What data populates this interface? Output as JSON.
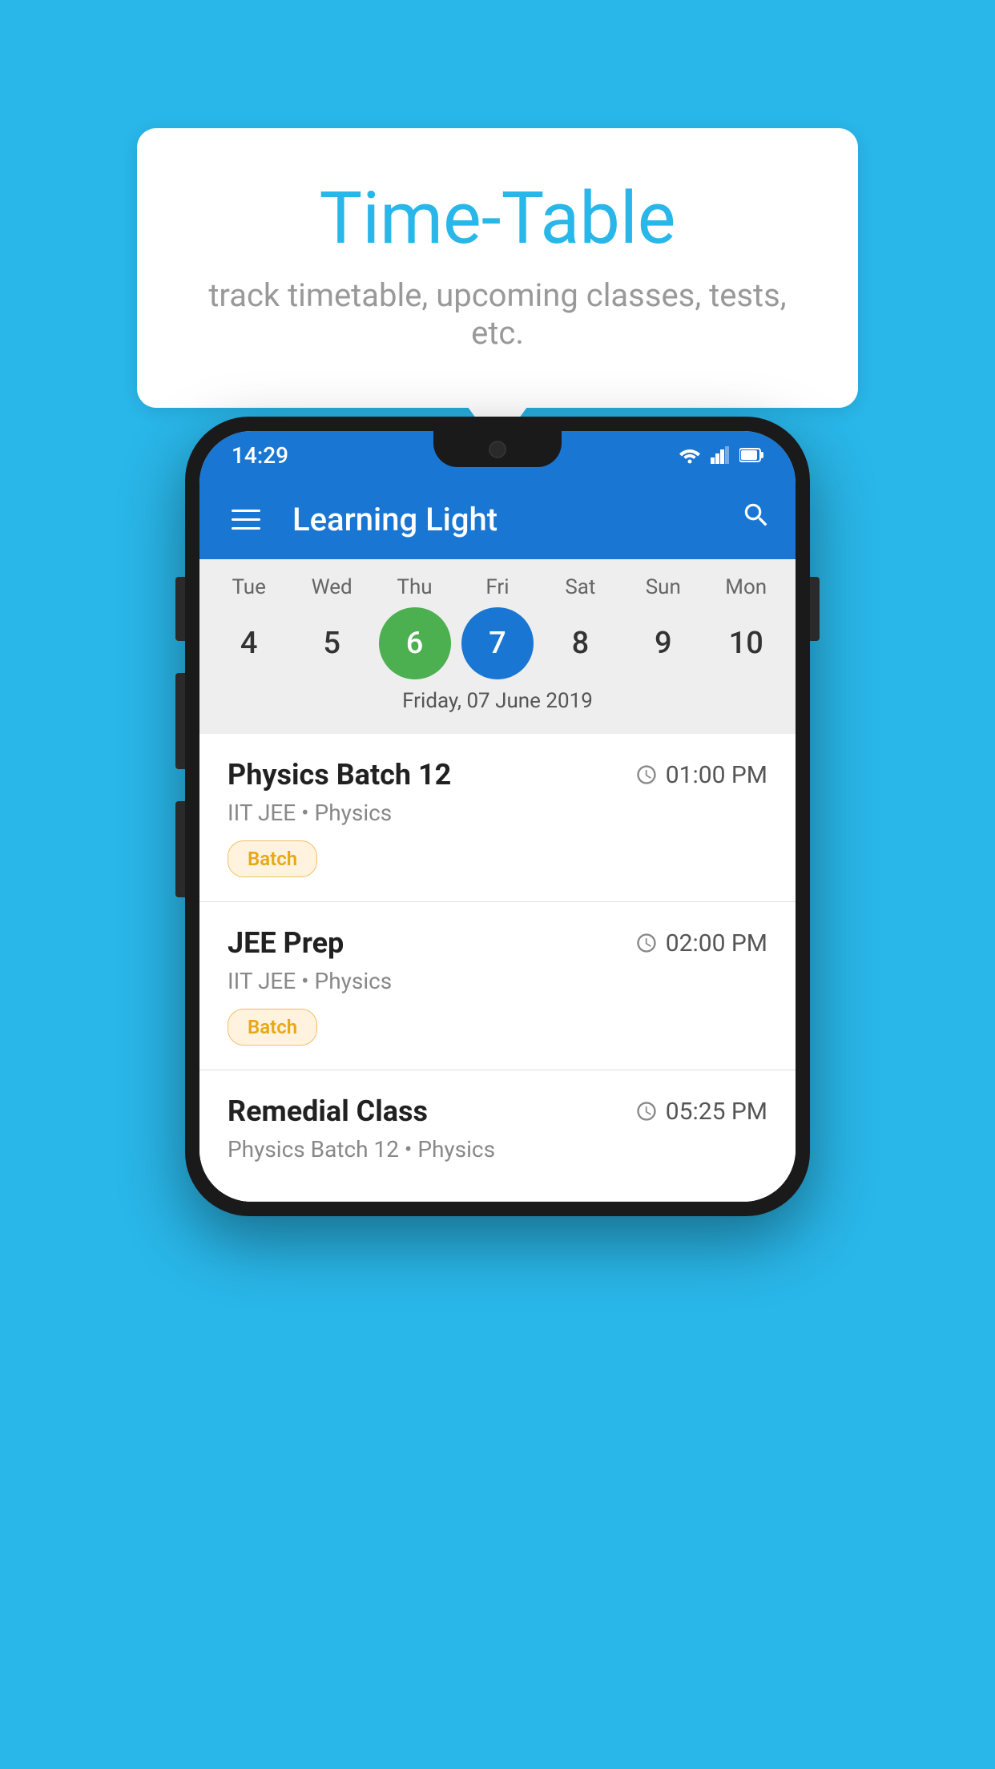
{
  "background_color": "#29b6e8",
  "tooltip_card": {
    "title": "Time-Table",
    "subtitle": "track timetable, upcoming classes, tests, etc."
  },
  "phone": {
    "status_bar": {
      "time": "14:29"
    },
    "app_bar": {
      "title": "Learning Light"
    },
    "calendar": {
      "days": [
        {
          "name": "Tue",
          "number": "4",
          "state": "normal"
        },
        {
          "name": "Wed",
          "number": "5",
          "state": "normal"
        },
        {
          "name": "Thu",
          "number": "6",
          "state": "today"
        },
        {
          "name": "Fri",
          "number": "7",
          "state": "selected"
        },
        {
          "name": "Sat",
          "number": "8",
          "state": "normal"
        },
        {
          "name": "Sun",
          "number": "9",
          "state": "normal"
        },
        {
          "name": "Mon",
          "number": "10",
          "state": "normal"
        }
      ],
      "selected_date_label": "Friday, 07 June 2019"
    },
    "schedule": {
      "items": [
        {
          "name": "Physics Batch 12",
          "time": "01:00 PM",
          "subtitle": "IIT JEE • Physics",
          "badge": "Batch"
        },
        {
          "name": "JEE Prep",
          "time": "02:00 PM",
          "subtitle": "IIT JEE • Physics",
          "badge": "Batch"
        },
        {
          "name": "Remedial Class",
          "time": "05:25 PM",
          "subtitle": "Physics Batch 12 • Physics",
          "badge": null
        }
      ]
    }
  },
  "icons": {
    "menu": "☰",
    "search": "🔍",
    "clock": "🕐"
  }
}
